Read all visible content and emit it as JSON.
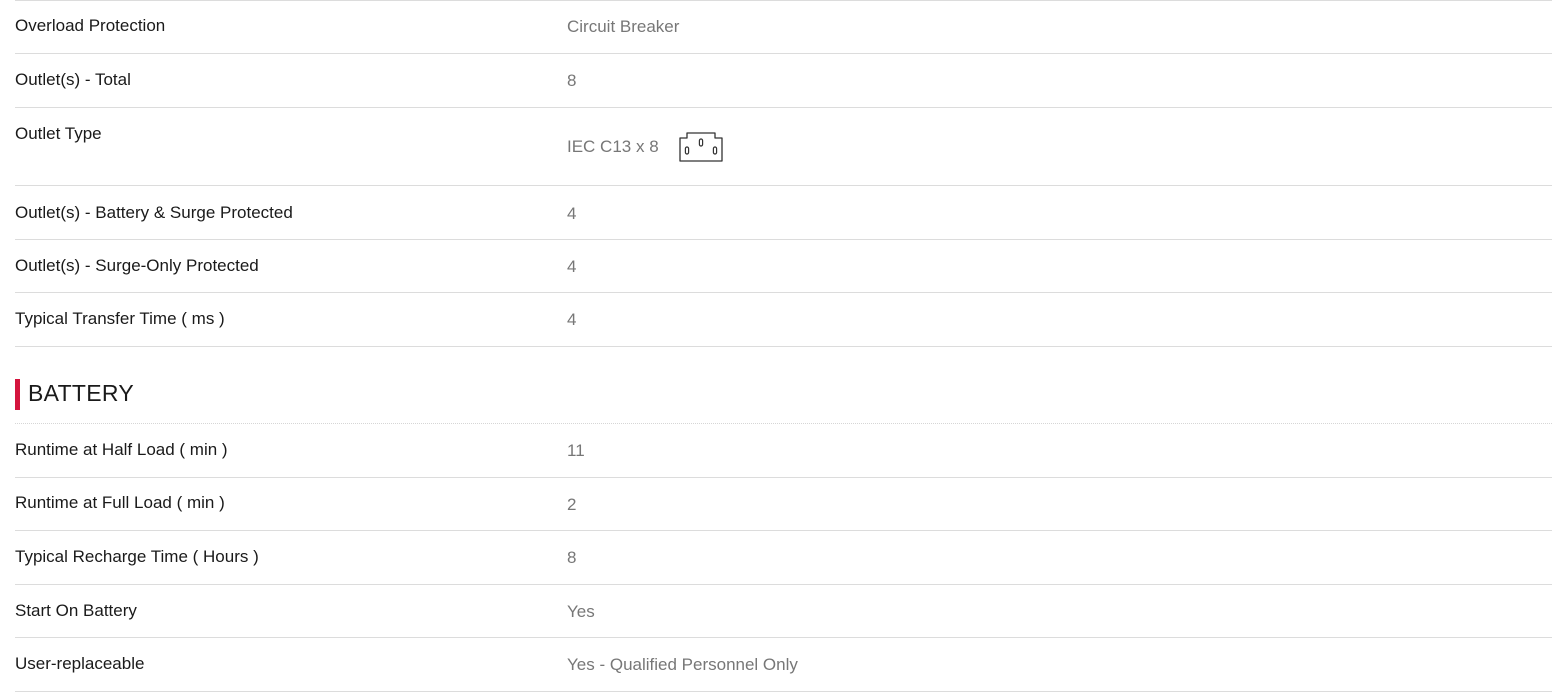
{
  "power_rows": [
    {
      "label": "Overload Protection",
      "value": "Circuit Breaker"
    },
    {
      "label": "Outlet(s) - Total",
      "value": "8"
    },
    {
      "label": "Outlet Type",
      "value": "IEC C13 x 8",
      "icon": "iec-c13-outlet-icon"
    },
    {
      "label": "Outlet(s) - Battery & Surge Protected",
      "value": "4"
    },
    {
      "label": "Outlet(s) - Surge-Only Protected",
      "value": "4"
    },
    {
      "label": "Typical Transfer Time ( ms )",
      "value": "4"
    }
  ],
  "battery_section": {
    "title": "BATTERY",
    "accent_color": "#d4143d"
  },
  "battery_rows": [
    {
      "label": "Runtime at Half Load ( min )",
      "value": "11"
    },
    {
      "label": "Runtime at Full Load ( min )",
      "value": "2"
    },
    {
      "label": "Typical Recharge Time ( Hours )",
      "value": "8"
    },
    {
      "label": "Start On Battery",
      "value": "Yes"
    },
    {
      "label": "User-replaceable",
      "value": "Yes - Qualified Personnel Only"
    }
  ]
}
